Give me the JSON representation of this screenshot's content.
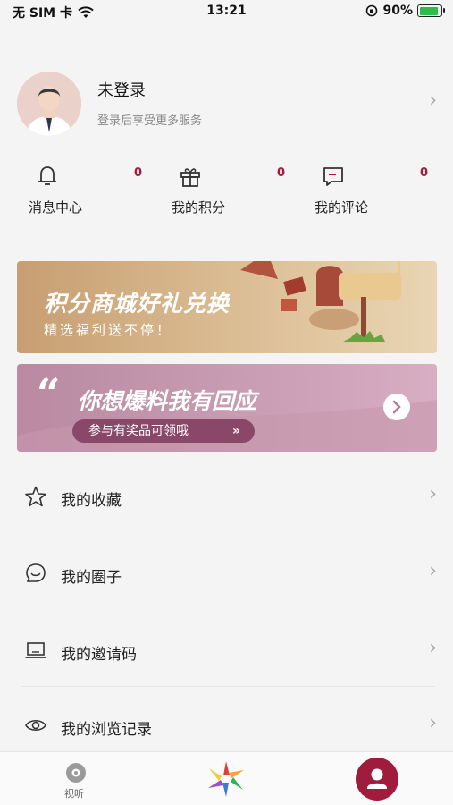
{
  "status_bar": {
    "carrier": "无 SIM 卡",
    "time": "13:21",
    "battery": "90%"
  },
  "profile": {
    "name": "未登录",
    "subtitle": "登录后享受更多服务"
  },
  "stats": [
    {
      "label": "消息中心",
      "count": "0",
      "icon": "bell-icon"
    },
    {
      "label": "我的积分",
      "count": "0",
      "icon": "gift-icon"
    },
    {
      "label": "我的评论",
      "count": "0",
      "icon": "comment-icon"
    }
  ],
  "banners": {
    "points": {
      "title": "积分商城好礼兑换",
      "subtitle": "精选福利送不停！"
    },
    "tipoff": {
      "quote": "“",
      "title": "你想爆料我有回应",
      "pill": "参与有奖品可领哦",
      "pill_arrows": "»"
    }
  },
  "menu": [
    {
      "label": "我的收藏",
      "icon": "star-icon"
    },
    {
      "label": "我的圈子",
      "icon": "chat-circle-icon"
    },
    {
      "label": "我的邀请码",
      "icon": "laptop-icon"
    },
    {
      "label": "我的浏览记录",
      "icon": "eye-icon"
    }
  ],
  "tabbar": {
    "video_label": "视听"
  },
  "colors": {
    "accent": "#a01c3c",
    "banner_gold": "#d9b98f",
    "banner_mauve": "#c79bb1"
  }
}
